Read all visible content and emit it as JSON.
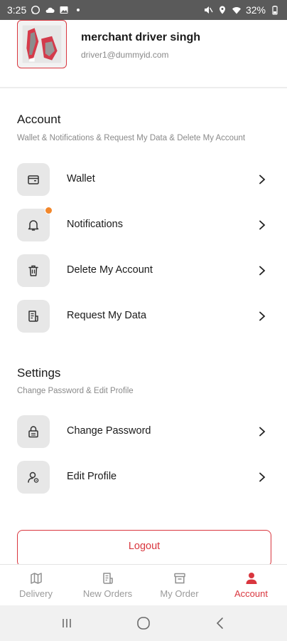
{
  "status_bar": {
    "time": "3:25",
    "battery": "32%",
    "left_icons": [
      "whatsapp-icon",
      "cloud-icon",
      "image-icon",
      "dot-icon"
    ],
    "right_icons": [
      "mute-icon",
      "location-icon",
      "wifi-icon",
      "battery-icon"
    ]
  },
  "profile": {
    "name": "merchant driver singh",
    "email": "driver1@dummyid.com"
  },
  "account_section": {
    "title": "Account",
    "subtitle": "Wallet & Notifications & Request My Data & Delete My Account",
    "items": [
      {
        "label": "Wallet",
        "icon": "wallet-icon"
      },
      {
        "label": "Notifications",
        "icon": "bell-icon"
      },
      {
        "label": "Delete My Account",
        "icon": "trash-icon"
      },
      {
        "label": "Request My Data",
        "icon": "document-icon"
      }
    ]
  },
  "settings_section": {
    "title": "Settings",
    "subtitle": "Change Password & Edit Profile",
    "items": [
      {
        "label": "Change Password",
        "icon": "lock-icon"
      },
      {
        "label": "Edit Profile",
        "icon": "user-edit-icon"
      }
    ]
  },
  "logout_label": "Logout",
  "bottom_nav": {
    "items": [
      {
        "label": "Delivery",
        "icon": "map-icon",
        "active": false
      },
      {
        "label": "New Orders",
        "icon": "receipt-icon",
        "active": false
      },
      {
        "label": "My Order",
        "icon": "archive-icon",
        "active": false
      },
      {
        "label": "Account",
        "icon": "person-icon",
        "active": true
      }
    ]
  },
  "colors": {
    "accent": "#d9363e",
    "notification_dot": "#f2872b",
    "icon_box": "#e7e7e7",
    "status_bar": "#5a5a5a"
  }
}
